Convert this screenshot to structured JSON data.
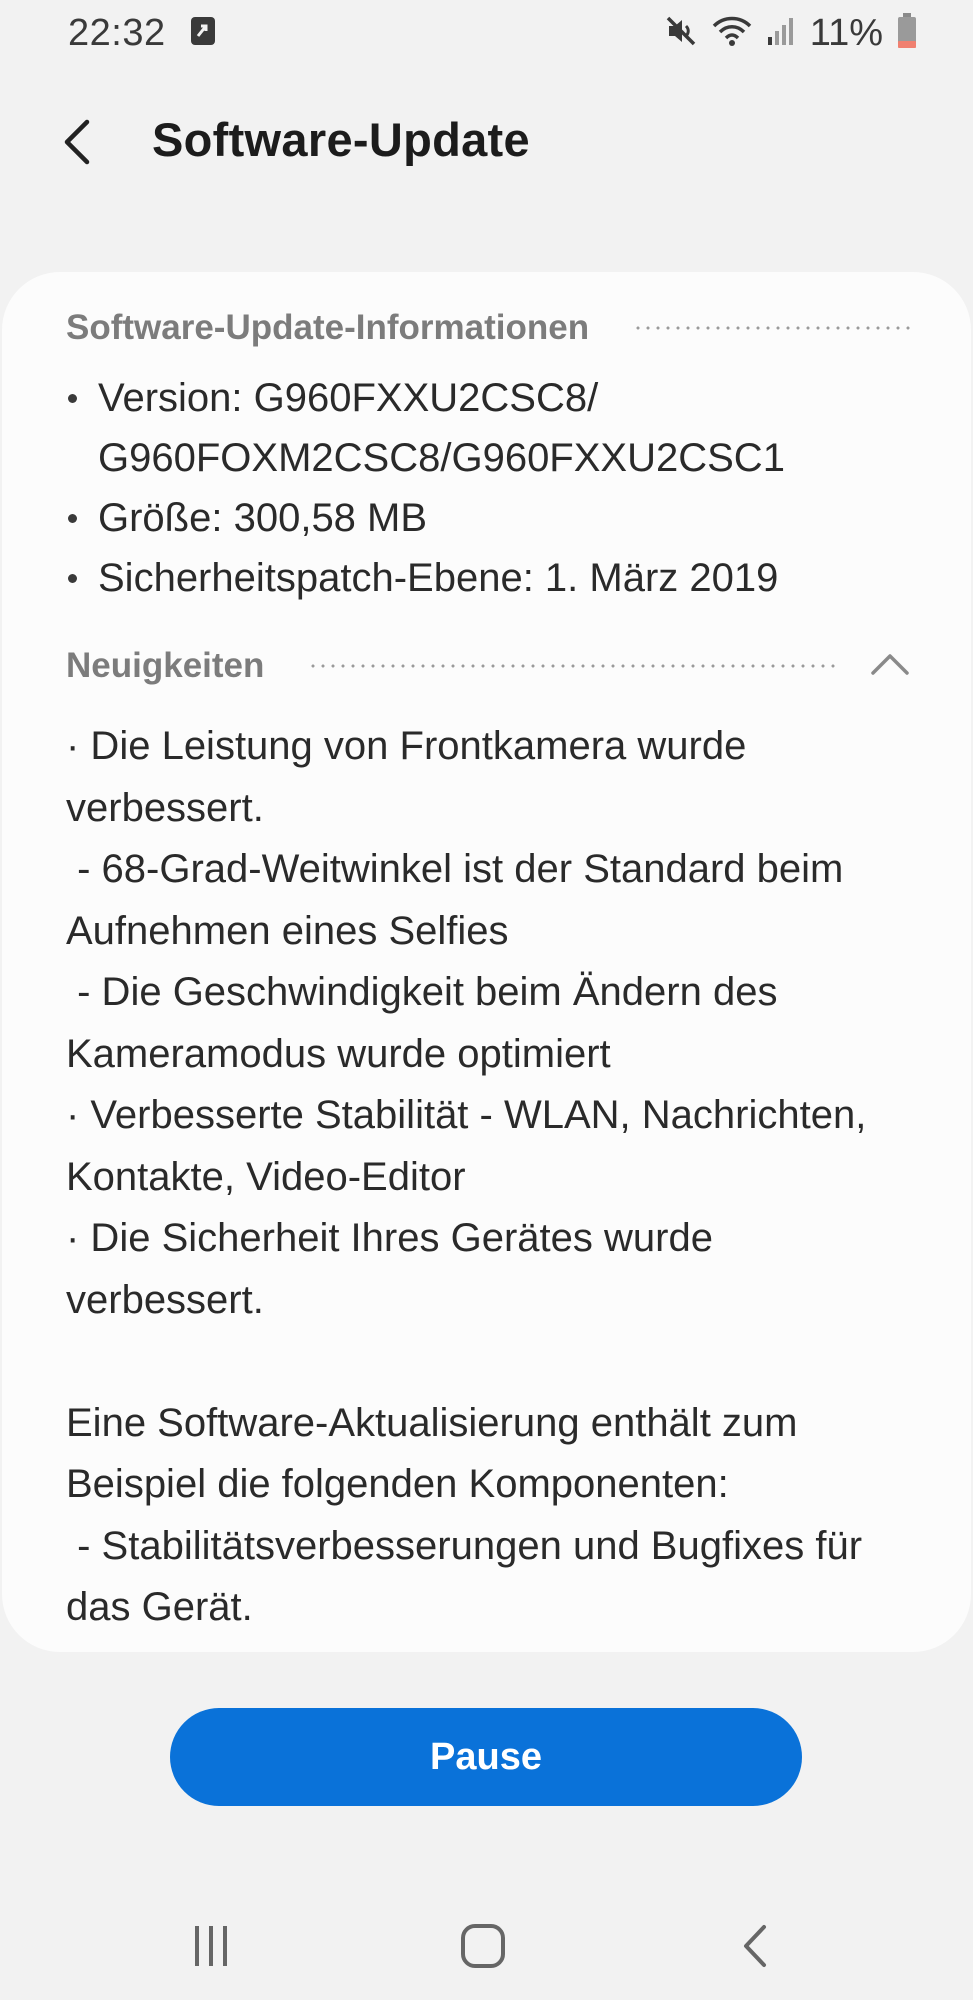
{
  "status_bar": {
    "time": "22:32",
    "battery_percent": "11%",
    "icons": [
      "notification-icon",
      "mute-icon",
      "wifi-icon",
      "signal-icon",
      "battery-icon"
    ],
    "battery_color": "#f08070"
  },
  "header": {
    "back_icon": "chevron-left-icon",
    "title": "Software-Update"
  },
  "update_info": {
    "section_title": "Software-Update-Informationen",
    "items": [
      "Version: G960FXXU2CSC8/\nG960FOXM2CSC8/G960FXXU2CSC1",
      "Größe: 300,58 MB",
      "Sicherheitspatch-Ebene: 1. März 2019"
    ]
  },
  "news": {
    "section_title": "Neuigkeiten",
    "expanded": true,
    "toggle_icon": "chevron-up-icon",
    "text": "· Die Leistung von Frontkamera wurde verbessert.\n - 68-Grad-Weitwinkel ist der Standard beim Aufnehmen eines Selfies\n - Die Geschwindigkeit beim Ändern des Kameramodus wurde optimiert\n· Verbesserte Stabilität - WLAN, Nachrichten, Kontakte, Video-Editor\n· Die Sicherheit Ihres Gerätes wurde verbessert.\n\nEine Software-Aktualisierung enthält zum Beispiel die folgenden Komponenten:\n - Stabilitätsverbesserungen und Bugfixes für das Gerät.\n - Neue und/oder erweiterte Funktionen"
  },
  "actions": {
    "pause_label": "Pause",
    "accent_color": "#0a72d9"
  },
  "nav_bar": {
    "recent_icon": "recent-apps-icon",
    "home_icon": "home-icon",
    "back_icon": "back-icon"
  }
}
